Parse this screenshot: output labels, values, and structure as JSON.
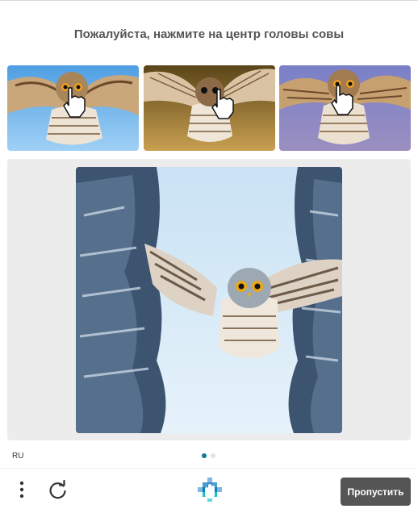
{
  "prompt": {
    "text": "Пожалуйста, нажмите на центр головы совы"
  },
  "examples": [
    {
      "background": "#6fb3ea",
      "icon": "hand-pointer-icon"
    },
    {
      "background": "#b88a3c",
      "icon": "hand-pointer-icon"
    },
    {
      "background": "#8a87c8",
      "icon": "hand-pointer-icon"
    }
  ],
  "task": {
    "icon": "owl-flying-snowy-forest"
  },
  "footer": {
    "language": "RU",
    "pagination": {
      "current": 1,
      "total": 2
    },
    "skip_label": "Пропустить",
    "menu_icon": "vertical-dots-icon",
    "refresh_icon": "refresh-icon",
    "logo_icon": "hcaptcha-logo-icon"
  },
  "colors": {
    "accent": "#0f7a94",
    "button": "#555555",
    "task_background": "#ececec"
  }
}
